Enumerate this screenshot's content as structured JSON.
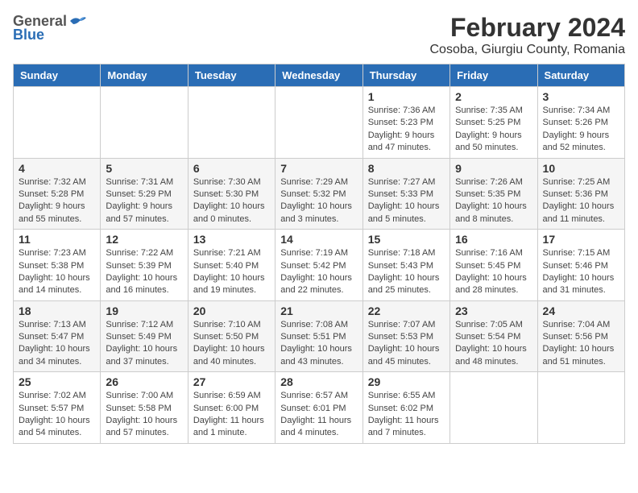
{
  "header": {
    "logo_general": "General",
    "logo_blue": "Blue",
    "title": "February 2024",
    "subtitle": "Cosoba, Giurgiu County, Romania"
  },
  "columns": [
    "Sunday",
    "Monday",
    "Tuesday",
    "Wednesday",
    "Thursday",
    "Friday",
    "Saturday"
  ],
  "weeks": [
    [
      {
        "day": "",
        "info": ""
      },
      {
        "day": "",
        "info": ""
      },
      {
        "day": "",
        "info": ""
      },
      {
        "day": "",
        "info": ""
      },
      {
        "day": "1",
        "info": "Sunrise: 7:36 AM\nSunset: 5:23 PM\nDaylight: 9 hours\nand 47 minutes."
      },
      {
        "day": "2",
        "info": "Sunrise: 7:35 AM\nSunset: 5:25 PM\nDaylight: 9 hours\nand 50 minutes."
      },
      {
        "day": "3",
        "info": "Sunrise: 7:34 AM\nSunset: 5:26 PM\nDaylight: 9 hours\nand 52 minutes."
      }
    ],
    [
      {
        "day": "4",
        "info": "Sunrise: 7:32 AM\nSunset: 5:28 PM\nDaylight: 9 hours\nand 55 minutes."
      },
      {
        "day": "5",
        "info": "Sunrise: 7:31 AM\nSunset: 5:29 PM\nDaylight: 9 hours\nand 57 minutes."
      },
      {
        "day": "6",
        "info": "Sunrise: 7:30 AM\nSunset: 5:30 PM\nDaylight: 10 hours\nand 0 minutes."
      },
      {
        "day": "7",
        "info": "Sunrise: 7:29 AM\nSunset: 5:32 PM\nDaylight: 10 hours\nand 3 minutes."
      },
      {
        "day": "8",
        "info": "Sunrise: 7:27 AM\nSunset: 5:33 PM\nDaylight: 10 hours\nand 5 minutes."
      },
      {
        "day": "9",
        "info": "Sunrise: 7:26 AM\nSunset: 5:35 PM\nDaylight: 10 hours\nand 8 minutes."
      },
      {
        "day": "10",
        "info": "Sunrise: 7:25 AM\nSunset: 5:36 PM\nDaylight: 10 hours\nand 11 minutes."
      }
    ],
    [
      {
        "day": "11",
        "info": "Sunrise: 7:23 AM\nSunset: 5:38 PM\nDaylight: 10 hours\nand 14 minutes."
      },
      {
        "day": "12",
        "info": "Sunrise: 7:22 AM\nSunset: 5:39 PM\nDaylight: 10 hours\nand 16 minutes."
      },
      {
        "day": "13",
        "info": "Sunrise: 7:21 AM\nSunset: 5:40 PM\nDaylight: 10 hours\nand 19 minutes."
      },
      {
        "day": "14",
        "info": "Sunrise: 7:19 AM\nSunset: 5:42 PM\nDaylight: 10 hours\nand 22 minutes."
      },
      {
        "day": "15",
        "info": "Sunrise: 7:18 AM\nSunset: 5:43 PM\nDaylight: 10 hours\nand 25 minutes."
      },
      {
        "day": "16",
        "info": "Sunrise: 7:16 AM\nSunset: 5:45 PM\nDaylight: 10 hours\nand 28 minutes."
      },
      {
        "day": "17",
        "info": "Sunrise: 7:15 AM\nSunset: 5:46 PM\nDaylight: 10 hours\nand 31 minutes."
      }
    ],
    [
      {
        "day": "18",
        "info": "Sunrise: 7:13 AM\nSunset: 5:47 PM\nDaylight: 10 hours\nand 34 minutes."
      },
      {
        "day": "19",
        "info": "Sunrise: 7:12 AM\nSunset: 5:49 PM\nDaylight: 10 hours\nand 37 minutes."
      },
      {
        "day": "20",
        "info": "Sunrise: 7:10 AM\nSunset: 5:50 PM\nDaylight: 10 hours\nand 40 minutes."
      },
      {
        "day": "21",
        "info": "Sunrise: 7:08 AM\nSunset: 5:51 PM\nDaylight: 10 hours\nand 43 minutes."
      },
      {
        "day": "22",
        "info": "Sunrise: 7:07 AM\nSunset: 5:53 PM\nDaylight: 10 hours\nand 45 minutes."
      },
      {
        "day": "23",
        "info": "Sunrise: 7:05 AM\nSunset: 5:54 PM\nDaylight: 10 hours\nand 48 minutes."
      },
      {
        "day": "24",
        "info": "Sunrise: 7:04 AM\nSunset: 5:56 PM\nDaylight: 10 hours\nand 51 minutes."
      }
    ],
    [
      {
        "day": "25",
        "info": "Sunrise: 7:02 AM\nSunset: 5:57 PM\nDaylight: 10 hours\nand 54 minutes."
      },
      {
        "day": "26",
        "info": "Sunrise: 7:00 AM\nSunset: 5:58 PM\nDaylight: 10 hours\nand 57 minutes."
      },
      {
        "day": "27",
        "info": "Sunrise: 6:59 AM\nSunset: 6:00 PM\nDaylight: 11 hours\nand 1 minute."
      },
      {
        "day": "28",
        "info": "Sunrise: 6:57 AM\nSunset: 6:01 PM\nDaylight: 11 hours\nand 4 minutes."
      },
      {
        "day": "29",
        "info": "Sunrise: 6:55 AM\nSunset: 6:02 PM\nDaylight: 11 hours\nand 7 minutes."
      },
      {
        "day": "",
        "info": ""
      },
      {
        "day": "",
        "info": ""
      }
    ]
  ]
}
